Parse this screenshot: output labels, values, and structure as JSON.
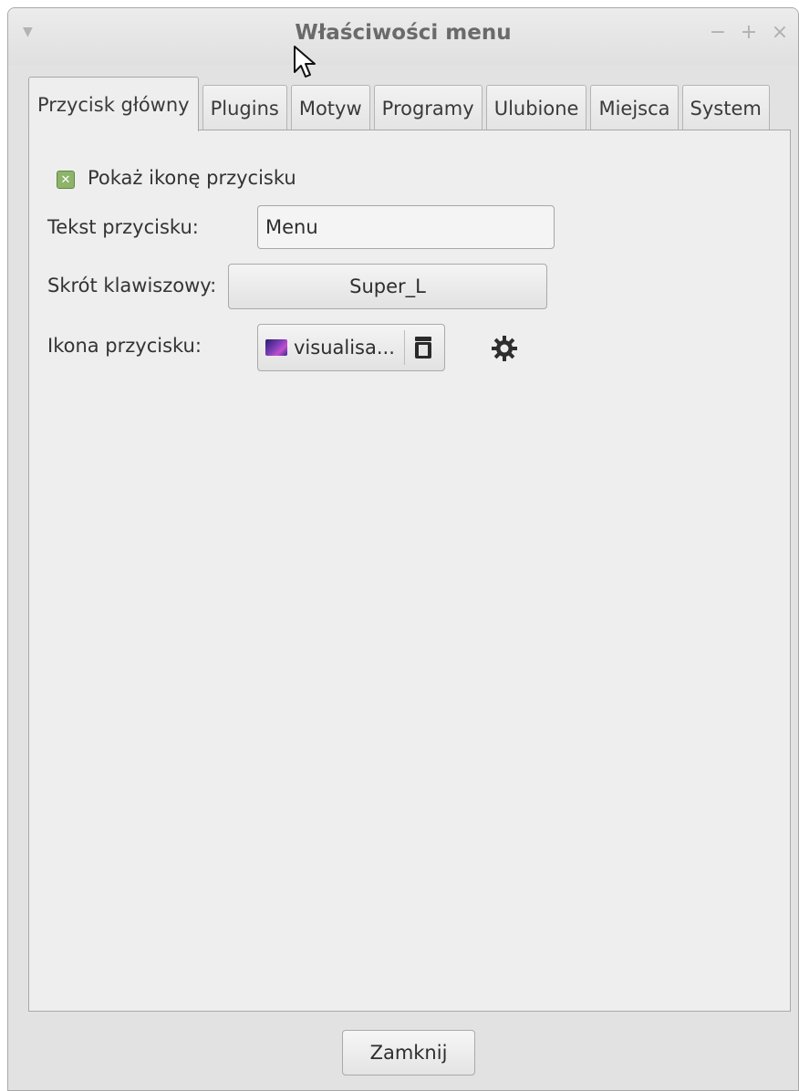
{
  "window": {
    "title": "Właściwości menu",
    "menu_glyph": "▼",
    "controls": {
      "minimize": "−",
      "maximize": "+",
      "close": "×"
    }
  },
  "tabs": [
    {
      "label": "Przycisk główny",
      "active": true
    },
    {
      "label": "Plugins",
      "active": false
    },
    {
      "label": "Motyw",
      "active": false
    },
    {
      "label": "Programy",
      "active": false
    },
    {
      "label": "Ulubione",
      "active": false
    },
    {
      "label": "Miejsca",
      "active": false
    },
    {
      "label": "System",
      "active": false
    }
  ],
  "main_button": {
    "show_icon_label": "Pokaż ikonę przycisku",
    "show_icon_checked": true,
    "text_label": "Tekst przycisku:",
    "text_value": "Menu",
    "shortcut_label": "Skrót klawiszowy:",
    "shortcut_value": "Super_L",
    "icon_label": "Ikona przycisku:",
    "icon_value": "visualisa..."
  },
  "footer": {
    "close_label": "Zamknij"
  },
  "icons": {
    "window_menu": "chevron-down-icon",
    "folder": "folder-icon",
    "settings": "gear-icon",
    "cursor": "mouse-pointer-icon"
  },
  "colors": {
    "window_bg": "#e2e2e2",
    "panel_bg": "#eeeeee",
    "checkbox_green": "#8db46a",
    "text": "#333333",
    "title_text": "#6a6a6a"
  }
}
